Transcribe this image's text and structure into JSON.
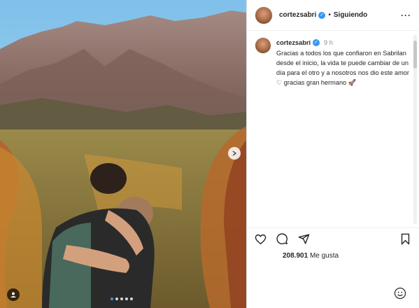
{
  "post": {
    "username": "cortezsabri",
    "follow_status": "Siguiendo",
    "time_ago": "9 h",
    "caption": "Gracias a todos los que confiaron en Sabrilan desde el inicio, la vida te puede cambiar de un día para el otro y a nosotros nos dio este amor ♡ gracias gran hermano 🚀",
    "likes_count": "208.901",
    "likes_label": "Me gusta",
    "carousel": {
      "slides": 5,
      "current": 1
    }
  },
  "colors": {
    "verified": "#3897f0",
    "text": "#262626",
    "muted": "#8e8e8e"
  },
  "icons": [
    "heart-icon",
    "comment-icon",
    "share-icon",
    "bookmark-icon",
    "more-options-icon",
    "emoji-icon",
    "next-arrow-icon",
    "user-tag-icon"
  ]
}
